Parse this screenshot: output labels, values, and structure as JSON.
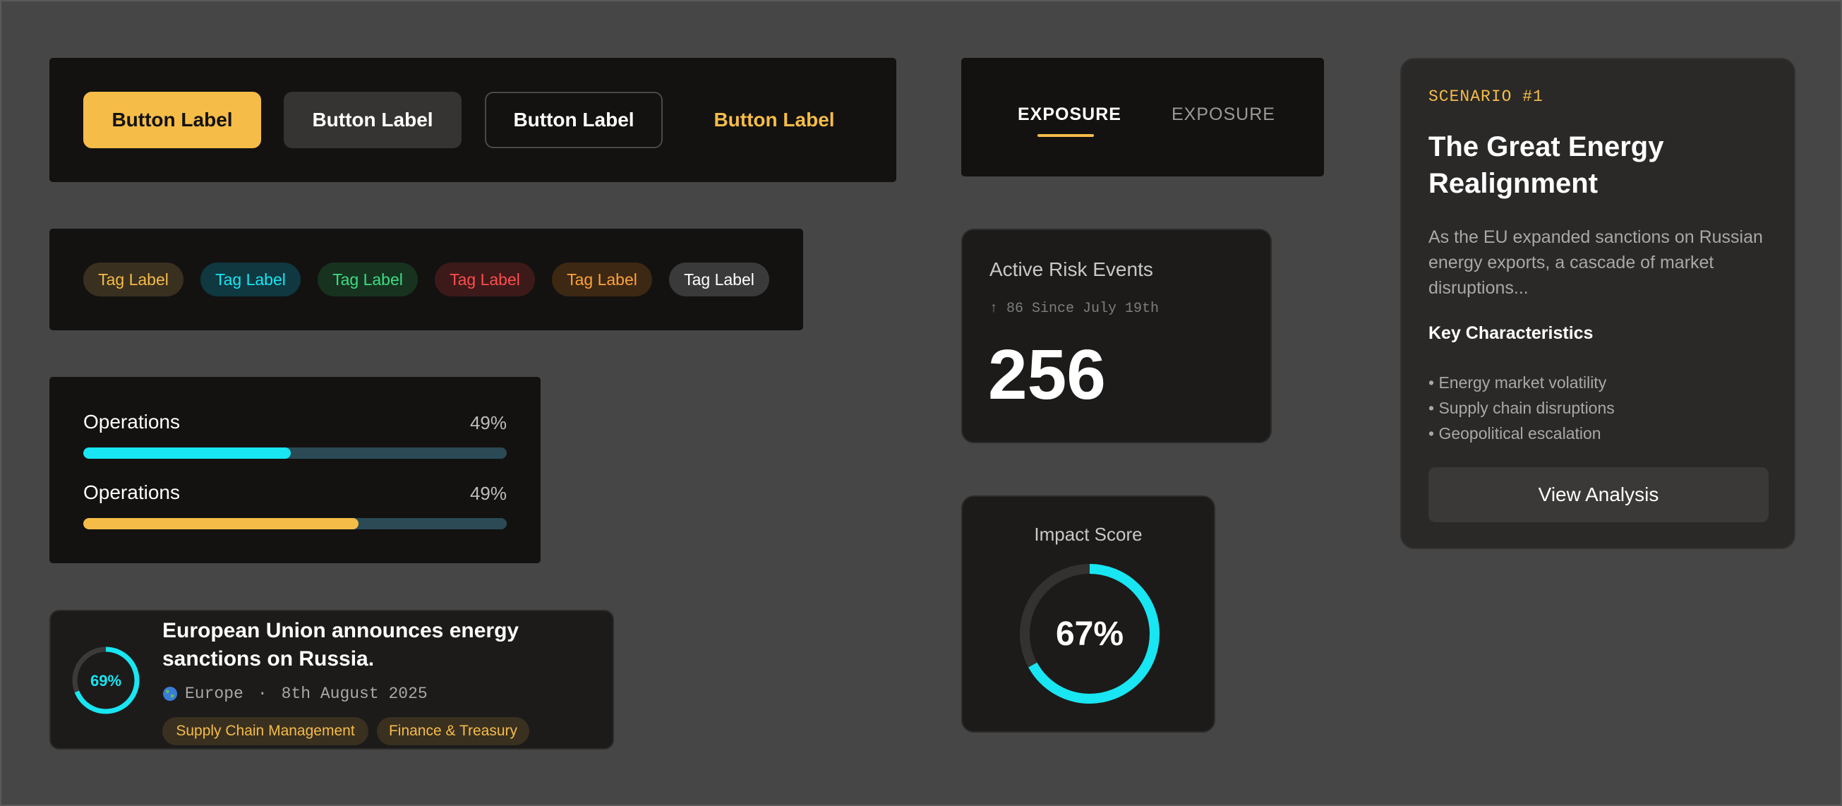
{
  "buttons": {
    "primary": "Button Label",
    "secondary": "Button Label",
    "outline": "Button Label",
    "ghost": "Button Label"
  },
  "tags": [
    {
      "label": "Tag Label",
      "color": "#f5bc48",
      "bg": "#3a3020"
    },
    {
      "label": "Tag Label",
      "color": "#18e6f2",
      "bg": "#0f3840"
    },
    {
      "label": "Tag Label",
      "color": "#3ddc84",
      "bg": "#17331f"
    },
    {
      "label": "Tag Label",
      "color": "#ff4d4d",
      "bg": "#3d1a1a"
    },
    {
      "label": "Tag Label",
      "color": "#ffa23a",
      "bg": "#3d2814"
    },
    {
      "label": "Tag Label",
      "color": "#ffffff",
      "bg": "#3a3a3a"
    }
  ],
  "progress": [
    {
      "label": "Operations",
      "value_text": "49%",
      "fill_fraction": 0.49,
      "color": "#18e6f2"
    },
    {
      "label": "Operations",
      "value_text": "49%",
      "fill_fraction": 0.65,
      "color": "#f5bc48"
    }
  ],
  "news": {
    "score_text": "69%",
    "score_fraction": 0.69,
    "title": "European Union announces energy sanctions on Russia.",
    "region_icon": "globe-icon",
    "region": "Europe",
    "separator": "·",
    "date": "8th August 2025",
    "tags": [
      "Supply Chain Management",
      "Finance & Treasury"
    ]
  },
  "tabs": {
    "items": [
      "EXPOSURE",
      "EXPOSURE"
    ],
    "active_index": 0
  },
  "risk": {
    "title": "Active Risk Events",
    "subtitle": "↑ 86 Since July 19th",
    "value": "256"
  },
  "impact": {
    "title": "Impact Score",
    "score_text": "67%",
    "score_fraction": 0.67
  },
  "scenario": {
    "eyebrow": "SCENARIO #1",
    "title": "The Great Energy Realignment",
    "description": "As the EU expanded sanctions on Russian energy exports, a cascade of market disruptions...",
    "heading": "Key Characteristics",
    "items": [
      "• Energy market volatility",
      "• Supply chain disruptions",
      "• Geopolitical escalation"
    ],
    "button": "View Analysis"
  },
  "colors": {
    "accent": "#f5bc48",
    "cyan": "#18e6f2",
    "background": "#464646"
  }
}
